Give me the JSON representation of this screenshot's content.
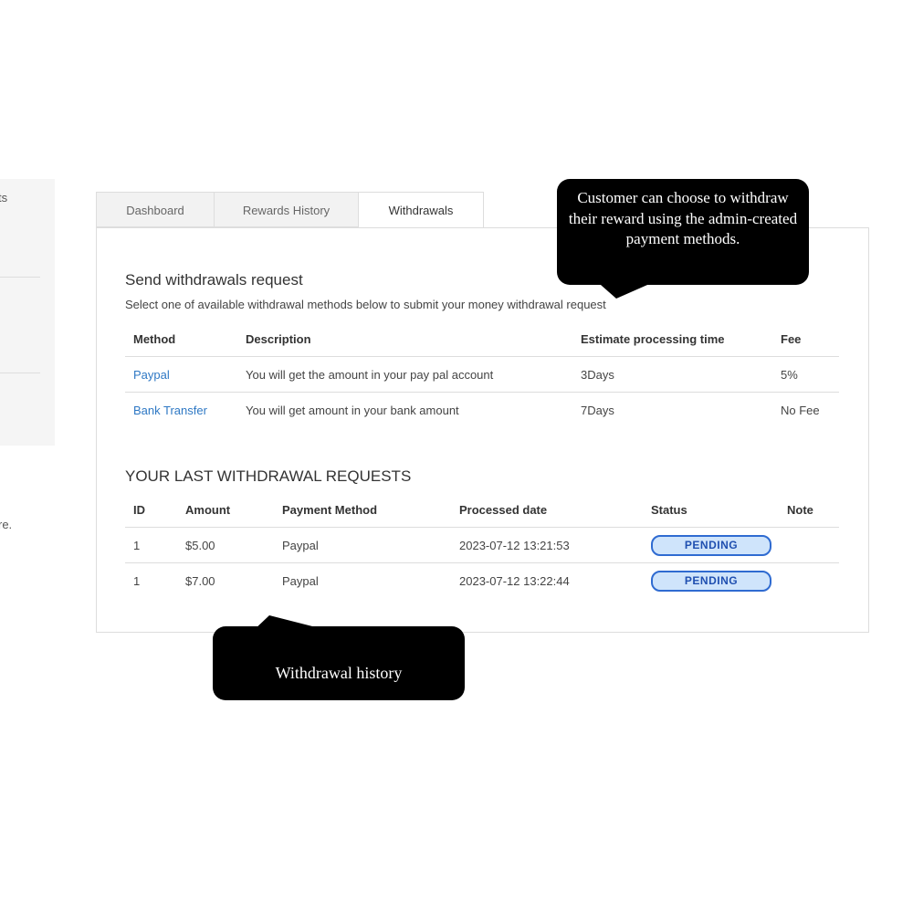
{
  "sidebar": {
    "fragment_top": "ts",
    "fragment_bottom": "re."
  },
  "tabs": [
    {
      "label": "Dashboard",
      "active": false
    },
    {
      "label": "Rewards History",
      "active": false
    },
    {
      "label": "Withdrawals",
      "active": true
    }
  ],
  "withdraw_request": {
    "title": "Send withdrawals request",
    "subtitle": "Select one of available withdrawal methods below to submit your money withdrawal request",
    "columns": [
      "Method",
      "Description",
      "Estimate processing time",
      "Fee"
    ],
    "rows": [
      {
        "method": "Paypal",
        "description": "You will get the amount in your pay pal account",
        "time": "3Days",
        "fee": "5%"
      },
      {
        "method": "Bank Transfer",
        "description": "You will get amount in your bank amount",
        "time": "7Days",
        "fee": "No Fee"
      }
    ]
  },
  "history": {
    "title": "YOUR LAST WITHDRAWAL REQUESTS",
    "columns": [
      "ID",
      "Amount",
      "Payment Method",
      "Processed date",
      "Status",
      "Note"
    ],
    "rows": [
      {
        "id": "1",
        "amount": "$5.00",
        "method": "Paypal",
        "date": "2023-07-12 13:21:53",
        "status": "PENDING",
        "note": ""
      },
      {
        "id": "1",
        "amount": "$7.00",
        "method": "Paypal",
        "date": "2023-07-12 13:22:44",
        "status": "PENDING",
        "note": ""
      }
    ]
  },
  "callouts": {
    "top": "Customer can choose to withdraw their reward using the admin-created payment methods.",
    "bottom": "Withdrawal history"
  },
  "colors": {
    "link": "#2e78c4",
    "badge_border": "#2f6bd1",
    "badge_fill": "#cfe4fb",
    "callout_bg": "#000000"
  }
}
